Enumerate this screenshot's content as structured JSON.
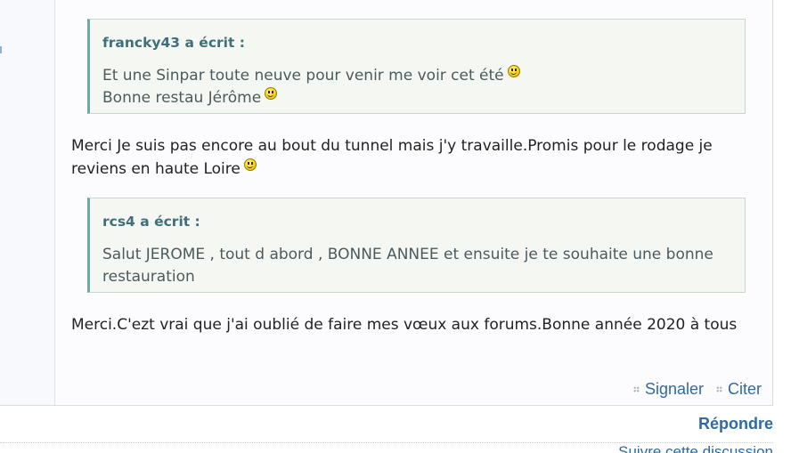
{
  "post": {
    "quotes": [
      {
        "author": "francky43 a écrit :",
        "lines": [
          "Et une Sinpar toute neuve pour venir me voir cet été",
          "Bonne restau Jérôme"
        ]
      },
      {
        "author": "rcs4 a écrit :",
        "text": "Salut JEROME , tout d abord , BONNE ANNEE  et ensuite je te souhaite une bonne restauration"
      }
    ],
    "messages": [
      "Merci Je suis pas encore au bout du tunnel mais j'y travaille.Promis pour le rodage je reviens en haute Loire",
      "Merci.C'ezt vrai que j'ai oublié de faire mes vœux aux forums.Bonne année 2020 à tous"
    ],
    "actions": {
      "report_label": "Signaler",
      "quote_label": "Citer"
    },
    "icons": {
      "smiley": "smiley-icon",
      "action_dots": "dots-grip-icon"
    }
  },
  "footer": {
    "reply_label": "Répondre",
    "follow_label": "Suivre cette discussion"
  },
  "colors": {
    "link": "#2f6aa3",
    "quote_author": "#3e6f7b",
    "quote_border": "#6ea7ad",
    "quote_background": "#f5f8f2"
  }
}
